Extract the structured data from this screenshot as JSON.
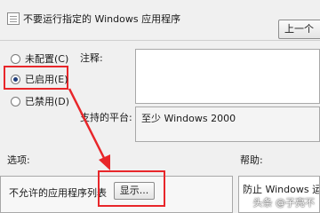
{
  "window": {
    "title": "不要运行指定的 Windows 应用程序",
    "prev_button": "上一个"
  },
  "state_options": [
    {
      "label": "未配置(C)",
      "selected": false
    },
    {
      "label": "已启用(E)",
      "selected": true
    },
    {
      "label": "已禁用(D)",
      "selected": false
    }
  ],
  "comment": {
    "label": "注释:",
    "value": ""
  },
  "supported": {
    "label": "支持的平台:",
    "value": "至少 Windows 2000"
  },
  "options": {
    "label": "选项:",
    "list_label": "不允许的应用程序列表",
    "show_button": "显示..."
  },
  "help": {
    "label": "帮助:",
    "text": "防止 Windows 运行"
  },
  "watermark": "头条 @子亮不"
}
